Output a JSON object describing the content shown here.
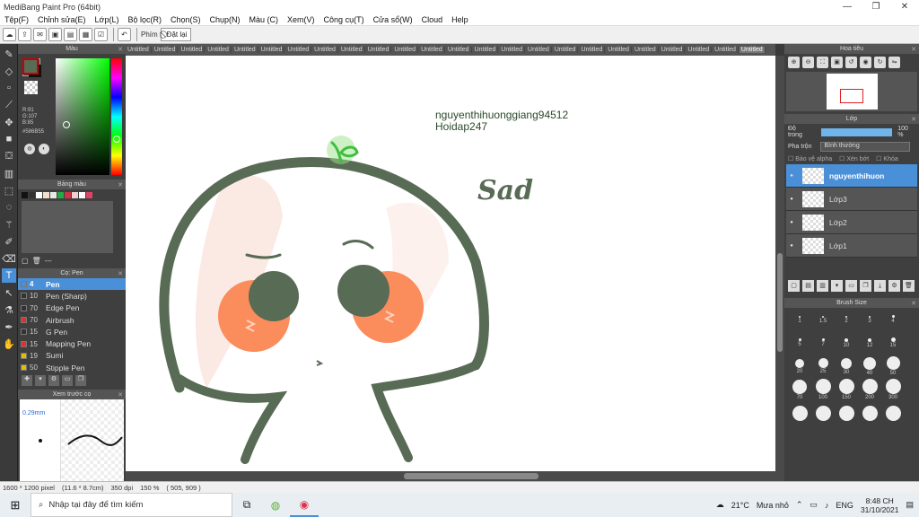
{
  "app": {
    "title": "MediBang Paint Pro (64bit)",
    "window_controls": [
      "—",
      "❐",
      "✕"
    ]
  },
  "menu": [
    "Tệp(F)",
    "Chỉnh sửa(E)",
    "Lớp(L)",
    "Bộ lọc(R)",
    "Chọn(S)",
    "Chụp(N)",
    "Màu (C)",
    "Xem(V)",
    "Công cụ(T)",
    "Cửa sổ(W)",
    "Cloud",
    "Help"
  ],
  "toolbar": {
    "shortcut_label": "Phím",
    "reset_label": "Đặt lại"
  },
  "color_panel": {
    "title": "Màu",
    "r": "R:91",
    "g": "G:107",
    "b": "B:85",
    "hex": "#586B55",
    "fg_color": "#586b55"
  },
  "palette_panel": {
    "title": "Bảng màu",
    "swatches": [
      "#111111",
      "#333333",
      "#ffffff",
      "#f0e0d0",
      "#e8e8e8",
      "#22aa44",
      "#cc3344",
      "#f0d0d0",
      "#ffffff",
      "#dd4466"
    ],
    "more_label": "---"
  },
  "brush_panel": {
    "title": "Cọ: Pen",
    "items": [
      {
        "size": "4",
        "name": "Pen",
        "color": "#4a90d9",
        "selected": true
      },
      {
        "size": "10",
        "name": "Pen (Sharp)",
        "color": "#333333",
        "selected": false
      },
      {
        "size": "70",
        "name": "Edge Pen",
        "color": "#333333",
        "selected": false
      },
      {
        "size": "70",
        "name": "Airbrush",
        "color": "#e03030",
        "selected": false
      },
      {
        "size": "15",
        "name": "G Pen",
        "color": "#333333",
        "selected": false
      },
      {
        "size": "15",
        "name": "Mapping Pen",
        "color": "#e03030",
        "selected": false
      },
      {
        "size": "19",
        "name": "Sumi",
        "color": "#e0c000",
        "selected": false
      },
      {
        "size": "50",
        "name": "Stipple Pen",
        "color": "#e0c000",
        "selected": false
      }
    ]
  },
  "preview_panel": {
    "title": "Xem trước cọ",
    "size": "0.29mm"
  },
  "tabs": {
    "label": "Untitled",
    "count": 24
  },
  "canvas": {
    "username": "nguyenthihuonggiang94512",
    "site": "Hoidap247",
    "sad_text": "Sad"
  },
  "navigator": {
    "title": "Hoa tiêu"
  },
  "layers_panel": {
    "title": "Lớp",
    "opacity_label": "Độ trong",
    "opacity_value": "100 %",
    "blend_label": "Pha trộn",
    "blend_value": "Bình thường",
    "protect_alpha": "Bảo vệ alpha",
    "clipping": "Xén bớt",
    "lock": "Khóa",
    "layers": [
      {
        "name": "nguyenthihuon",
        "selected": true
      },
      {
        "name": "Lớp3",
        "selected": false
      },
      {
        "name": "Lớp2",
        "selected": false
      },
      {
        "name": "Lớp1",
        "selected": false
      }
    ]
  },
  "brush_size_panel": {
    "title": "Brush Size",
    "sizes": [
      "1",
      "1.5",
      "2",
      "3",
      "4",
      "5",
      "7",
      "10",
      "12",
      "15",
      "20",
      "25",
      "30",
      "40",
      "50",
      "70",
      "100",
      "150",
      "200",
      "300",
      "",
      "",
      "",
      "",
      ""
    ]
  },
  "status": {
    "pixels": "1600 * 1200 pixel",
    "cm": "(11.6 * 8.7cm)",
    "dpi": "350 dpi",
    "zoom": "150 %",
    "coords": "( 505, 909 )"
  },
  "taskbar": {
    "search_placeholder": "Nhập tại đây để tìm kiếm",
    "temperature": "21°C",
    "weather": "Mưa nhỏ",
    "lang": "ENG",
    "time": "8:48 CH",
    "date": "31/10/2021"
  }
}
